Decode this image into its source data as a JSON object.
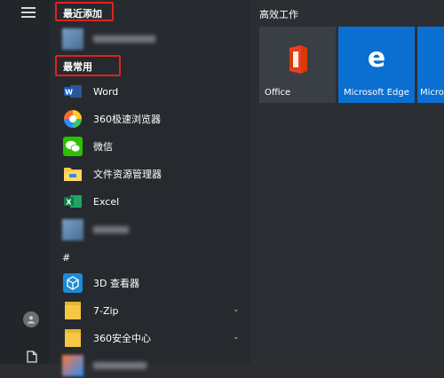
{
  "sections": {
    "recently_added": "最近添加",
    "most_used": "最常用",
    "hash_group": "#"
  },
  "apps_most_used": [
    {
      "label": "Word"
    },
    {
      "label": "360极速浏览器"
    },
    {
      "label": "微信"
    },
    {
      "label": "文件资源管理器"
    },
    {
      "label": "Excel"
    }
  ],
  "apps_hash": [
    {
      "label": "3D 查看器"
    },
    {
      "label": "7-Zip"
    },
    {
      "label": "360安全中心"
    }
  ],
  "tiles": {
    "group_title": "高效工作",
    "items": [
      {
        "label": "Office",
        "color": "#3a3f46"
      },
      {
        "label": "Microsoft Edge",
        "color": "#0a6fd1"
      },
      {
        "label": "Micro",
        "color": "#0a6fd1"
      }
    ]
  },
  "colors": {
    "highlight_border": "#e0231b",
    "tile_blue": "#0a6fd1"
  }
}
